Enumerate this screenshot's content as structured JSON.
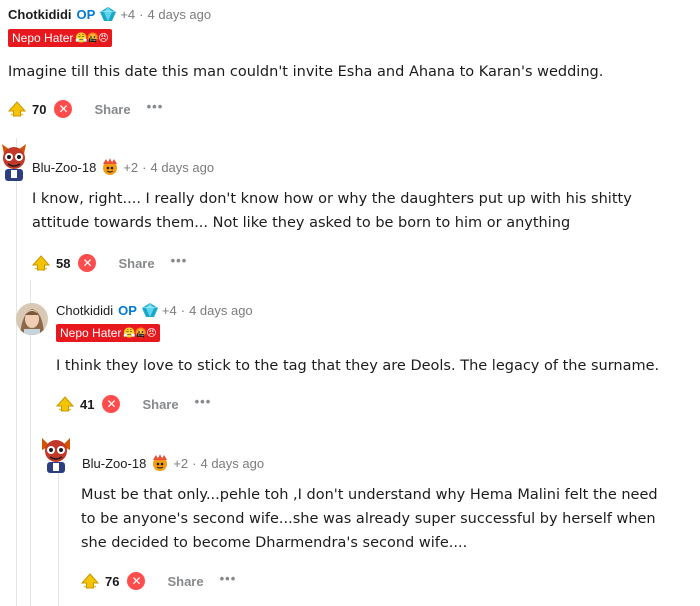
{
  "comments": [
    {
      "author": "Chotkididi",
      "op_label": "OP",
      "karma": "+4",
      "time": "4 days ago",
      "flair": "Nepo Hater",
      "flair_emoji": "😤🤬😠",
      "text": "Imagine till this date this man couldn't invite Esha and Ahana to Karan's wedding.",
      "score": "70",
      "share_label": "Share",
      "more_label": "•••"
    },
    {
      "author": "Blu-Zoo-18",
      "karma": "+2",
      "time": "4 days ago",
      "text_lines": [
        "I know, right.... I really don't know how or why the daughters put up with his shitty",
        "attitude towards them... Not like they asked to be born to him or anything"
      ],
      "score": "58",
      "share_label": "Share",
      "more_label": "•••"
    },
    {
      "author": "Chotkididi",
      "op_label": "OP",
      "karma": "+4",
      "time": "4 days ago",
      "flair": "Nepo Hater",
      "flair_emoji": "😤🤬😠",
      "text": "I think they love to stick to the tag that they are Deols. The legacy of the surname.",
      "score": "41",
      "share_label": "Share",
      "more_label": "•••"
    },
    {
      "author": "Blu-Zoo-18",
      "karma": "+2",
      "time": "4 days ago",
      "text_lines": [
        "Must be that only...pehle toh ,I don't understand why Hema Malini felt the need",
        "to be anyone's second wife...she was already super successful by herself when",
        "she decided to become Dharmendra's second wife...."
      ],
      "score": "76",
      "share_label": "Share",
      "more_label": "•••"
    }
  ],
  "separator": "·",
  "colors": {
    "op": "#0079d3",
    "flair_bg": "#e8191e",
    "downvote": "#ff4d4d",
    "muted": "#7c7c7c"
  }
}
